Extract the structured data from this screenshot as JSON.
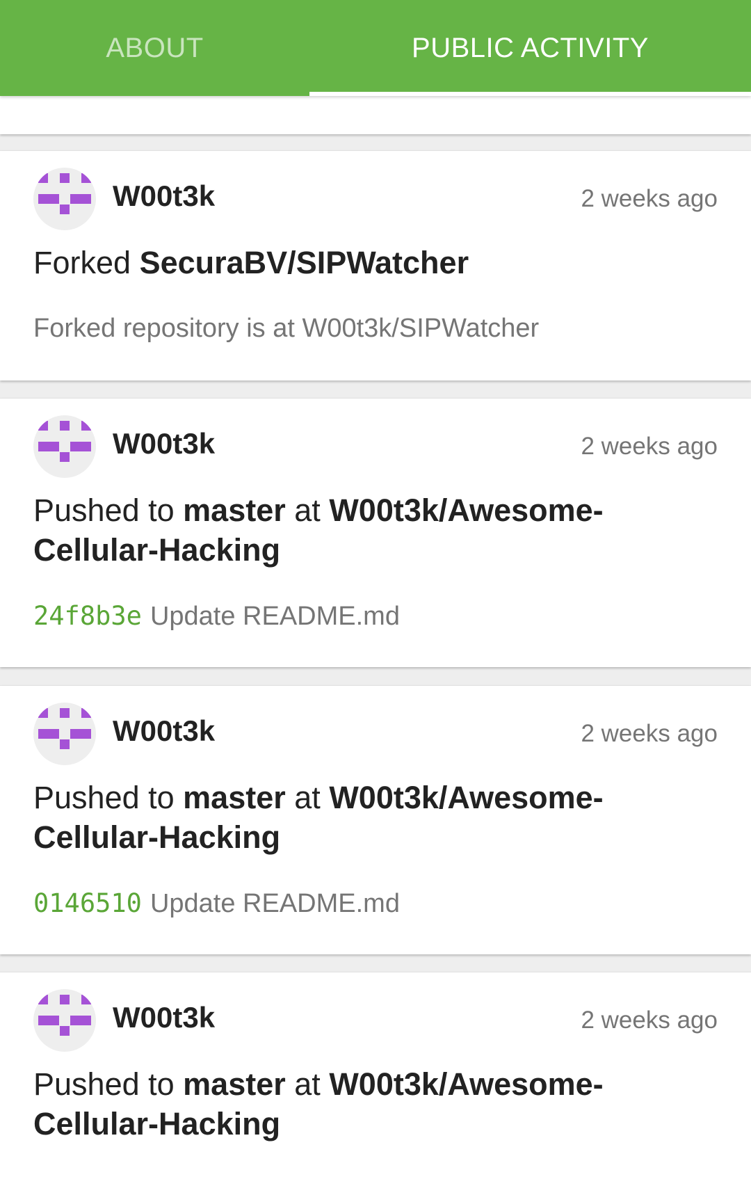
{
  "tabs": {
    "about": "ABOUT",
    "public_activity": "PUBLIC ACTIVITY",
    "active": "public_activity"
  },
  "colors": {
    "tabbar": "#66b446",
    "sha": "#5aa637",
    "avatar_pattern": "#a552d6"
  },
  "events": [
    {
      "user": "W00t3k",
      "avatar": "identicon-avatar",
      "time": "2 weeks ago",
      "action": "Forked",
      "target": "SecuraBV/SIPWatcher",
      "detail": "Forked repository is at W00t3k/SIPWatcher"
    },
    {
      "user": "W00t3k",
      "avatar": "identicon-avatar",
      "time": "2 weeks ago",
      "action": "Pushed to",
      "branch": "master",
      "connector": "at",
      "repo": "W00t3k/Awesome-Cellular-Hacking",
      "sha": "24f8b3e",
      "message": "Update README.md"
    },
    {
      "user": "W00t3k",
      "avatar": "identicon-avatar",
      "time": "2 weeks ago",
      "action": "Pushed to",
      "branch": "master",
      "connector": "at",
      "repo": "W00t3k/Awesome-Cellular-Hacking",
      "sha": "0146510",
      "message": "Update README.md"
    },
    {
      "user": "W00t3k",
      "avatar": "identicon-avatar",
      "time": "2 weeks ago",
      "action": "Pushed to",
      "branch": "master",
      "connector": "at",
      "repo": "W00t3k/Awesome-Cellular-Hacking"
    }
  ]
}
